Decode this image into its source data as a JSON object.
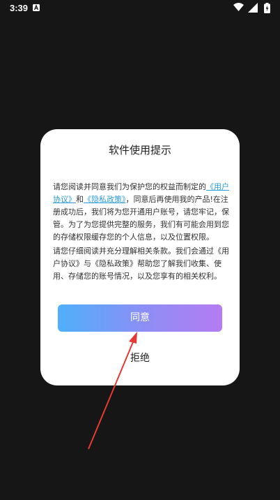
{
  "status_bar": {
    "time": "3:39",
    "notification_icon": "a-letter-icon",
    "wifi_icon": "wifi-icon",
    "signal_icon": "cellular-signal-icon",
    "battery_icon": "battery-charging-icon"
  },
  "dialog": {
    "title": "软件使用提示",
    "para1": {
      "intro": "请您阅读并同意我们为保护您的权益而制定的",
      "user_agreement_link": "《用户协议》",
      "and": "和",
      "privacy_policy_link": "《隐私政策》",
      "rest": "，同意后再使用我的产品!在注册成功后，我们将为您开通用户账号，请您牢记，保管。为了为您提供完整的服务，我们有可能会用到您的存储权限缓存您的个人信息，以及位置权限。"
    },
    "para2": "请您仔细阅读并充分理解相关条款。我们会通过《用户协议》与《隐私政策》帮助您了解我们收集、使用、存储您的账号情况，以及您享有的相关权利。",
    "agree_label": "同意",
    "reject_label": "拒绝"
  },
  "colors": {
    "background": "#161616",
    "dialog_background": "#ffffff",
    "link": "#2d9cdb",
    "button_gradient_start": "#4fb0fb",
    "button_gradient_end": "#b57cf2",
    "annotation_arrow": "#e53935"
  }
}
